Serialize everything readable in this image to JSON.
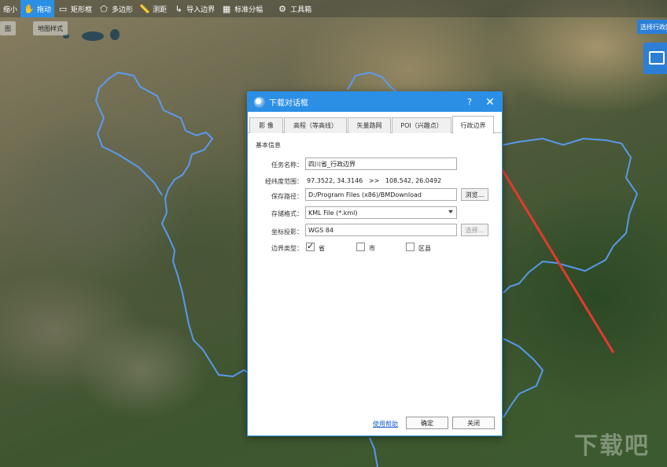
{
  "toolbar": {
    "items": [
      {
        "label": "缩小",
        "icon": "zoom-out-icon"
      },
      {
        "label": "拖动",
        "icon": "hand-icon",
        "active": true
      },
      {
        "label": "矩形框",
        "icon": "rectangle-icon"
      },
      {
        "label": "多边形",
        "icon": "polygon-icon"
      },
      {
        "label": "测距",
        "icon": "ruler-icon"
      },
      {
        "label": "导入边界",
        "icon": "import-boundary-icon"
      },
      {
        "label": "标准分幅",
        "icon": "grid-icon"
      },
      {
        "label": "工具箱",
        "icon": "toolbox-icon"
      }
    ],
    "row2": [
      "图",
      "地图样式"
    ]
  },
  "right_panel": {
    "select_label": "选择行政区",
    "download_icon": "download-icon"
  },
  "dialog": {
    "title": "下载对话框",
    "help": "?",
    "close": "✕",
    "tabs": [
      "影 像",
      "高程（等高线）",
      "矢量路网",
      "POI（兴趣点）",
      "行政边界"
    ],
    "selected_tab": "行政边界",
    "group_label": "基本信息",
    "task_name": {
      "label": "任务名称：",
      "value": "四川省_行政边界"
    },
    "range": {
      "label": "经纬度范围：",
      "value": "97.3522, 34.3146   >>   108.542, 26.0492"
    },
    "save_path": {
      "label": "保存路径：",
      "value": "D:/Program Files (x86)/BMDownload",
      "button": "浏览..."
    },
    "format": {
      "label": "存储格式：",
      "value": "KML File (*.kml)"
    },
    "projection": {
      "label": "坐标投影：",
      "value": "WGS 84",
      "button": "选择..."
    },
    "boundary": {
      "label": "边界类型：",
      "options": [
        {
          "label": "省",
          "checked": true
        },
        {
          "label": "市",
          "checked": false
        },
        {
          "label": "区县",
          "checked": false
        }
      ]
    },
    "footer": {
      "help_link": "使用帮助",
      "ok": "确定",
      "close": "关闭"
    }
  },
  "colors": {
    "accent": "#2b8fe6",
    "boundary_line": "#5aa0ff",
    "arrow": "#e23a2e"
  },
  "watermark": "下载吧"
}
